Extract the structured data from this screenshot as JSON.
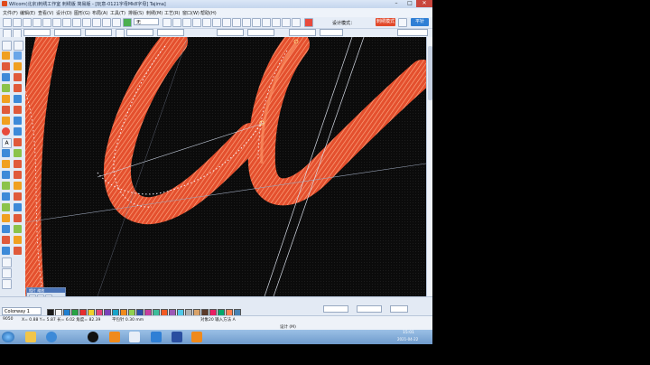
{
  "window": {
    "title": "Wilcom(北京)刺绣工作室   刺绣版 简易版 - [玩意-0121字母Mk8字母]              Tajima]"
  },
  "menu": [
    "文件(F)",
    "编辑(E)",
    "查看(V)",
    "设计(D)",
    "图形(G)",
    "布局(A)",
    "工具(T)",
    "排版(S)",
    "刺绣(M)",
    "工艺(R)",
    "窗口(W)",
    "帮助(H)"
  ],
  "toolbar": {
    "mode_value": "无",
    "design_mode_label": "设计模式：",
    "stitch_mode_button": "刺绣模式",
    "stitch_type_button": "平针"
  },
  "palette": {
    "colorway": "Colorway 1",
    "panel_title": "相片 缩放",
    "swatches": [
      "#1a1a1a",
      "#f5f5f5",
      "#1f7fd0",
      "#27a345",
      "#e62f2f",
      "#f0d12a",
      "#e4447a",
      "#7a43b8",
      "#18a4c8",
      "#f08a1c",
      "#8fd14f",
      "#2b4fa8",
      "#c73fa0",
      "#3dbd9b",
      "#f15a24",
      "#9b59b6",
      "#50c8e8",
      "#b0b0b0",
      "#d9a36a",
      "#5b3a29",
      "#e91e63",
      "#00a86b",
      "#ff7f50",
      "#4682b4"
    ]
  },
  "status": {
    "left_count": "9050",
    "coords": "X= 0.88 Y= 5.87 长= 6.02 角度= 82.39",
    "stitch": "平包针 0.30 mm",
    "object": "对象20 输入方法 A",
    "design": "设计 (M)"
  },
  "clock": {
    "time": "15:01",
    "date": "2021-04-22"
  },
  "icons": [
    "start-orb-icon",
    "explorer-icon",
    "internet-explorer-icon",
    "qq-icon",
    "ucbrowser-icon",
    "wilcom-icon",
    "dreamweaver-icon",
    "emb-icon",
    "help-icon"
  ]
}
